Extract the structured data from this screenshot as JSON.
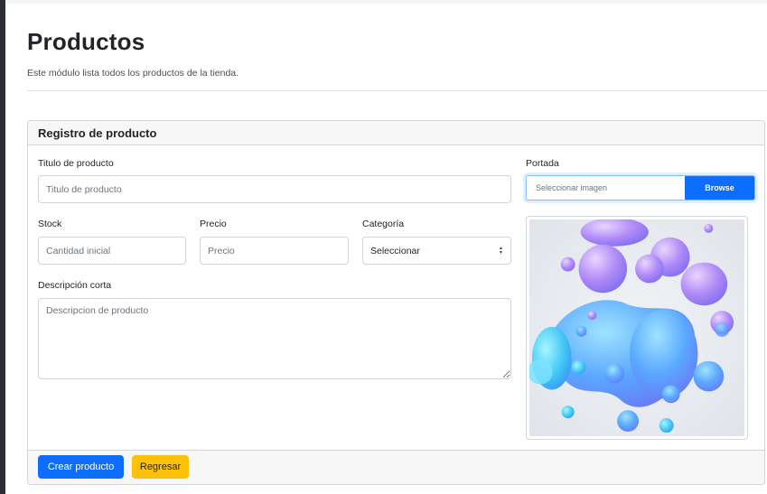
{
  "page": {
    "title": "Productos",
    "subtitle": "Este módulo lista todos los productos de la tienda."
  },
  "card": {
    "title": "Registro de producto"
  },
  "form": {
    "title_label": "Titulo de producto",
    "title_placeholder": "Titulo de producto",
    "stock_label": "Stock",
    "stock_placeholder": "Cantidad inicial",
    "price_label": "Precio",
    "price_placeholder": "Precio",
    "category_label": "Categoría",
    "category_selected": "Seleccionar",
    "description_label": "Descripción corta",
    "description_placeholder": "Descripcion de producto",
    "cover_label": "Portada",
    "cover_placeholder": "Seleccionar imagen",
    "browse_label": "Browse"
  },
  "footer": {
    "create_label": "Crear producto",
    "back_label": "Regresar"
  },
  "colors": {
    "primary": "#0d6efd",
    "warning": "#ffc107",
    "title_text": "#212529",
    "border": "#ced4da"
  }
}
